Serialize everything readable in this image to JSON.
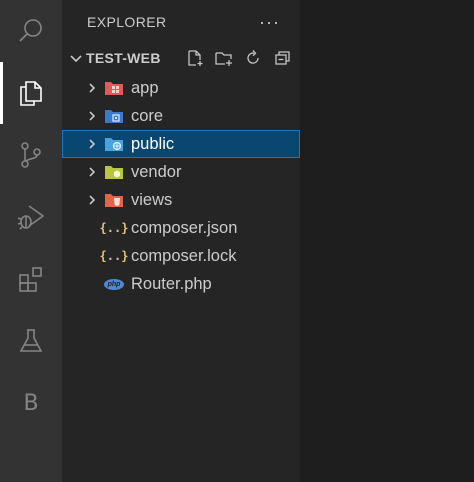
{
  "activity_bar": {
    "items": [
      {
        "name": "search",
        "icon": "search-icon"
      },
      {
        "name": "explorer",
        "icon": "files-icon",
        "active": true
      },
      {
        "name": "source-control",
        "icon": "source-control-icon"
      },
      {
        "name": "run-debug",
        "icon": "run-debug-icon"
      },
      {
        "name": "extensions",
        "icon": "extensions-icon"
      },
      {
        "name": "testing",
        "icon": "flask-icon"
      },
      {
        "name": "b-extension",
        "icon": "b-letter-icon",
        "letter": "B"
      }
    ]
  },
  "sidebar": {
    "title": "EXPLORER",
    "more": "···",
    "section": {
      "title": "TEST-WEB",
      "actions": [
        "new-file-icon",
        "new-folder-icon",
        "refresh-icon",
        "collapse-all-icon"
      ]
    },
    "items": [
      {
        "label": "app",
        "type": "folder",
        "icon": "folder-app-icon",
        "color": "#e05a5a"
      },
      {
        "label": "core",
        "type": "folder",
        "icon": "folder-core-icon",
        "color": "#3b7ac8"
      },
      {
        "label": "public",
        "type": "folder",
        "icon": "folder-public-icon",
        "color": "#4aa3df",
        "selected": true
      },
      {
        "label": "vendor",
        "type": "folder",
        "icon": "folder-vendor-icon",
        "color": "#b8c642"
      },
      {
        "label": "views",
        "type": "folder",
        "icon": "folder-views-icon",
        "color": "#e3624a"
      },
      {
        "label": "composer.json",
        "type": "file",
        "icon": "json-icon",
        "glyph": "{..}"
      },
      {
        "label": "composer.lock",
        "type": "file",
        "icon": "json-icon",
        "glyph": "{..}"
      },
      {
        "label": "Router.php",
        "type": "file",
        "icon": "php-icon",
        "glyph": "php"
      }
    ]
  },
  "colors": {
    "activity_bar": "#333333",
    "sidebar": "#252526",
    "editor": "#1e1e1e",
    "selection": "#094771",
    "selection_border": "#1e76b8"
  }
}
